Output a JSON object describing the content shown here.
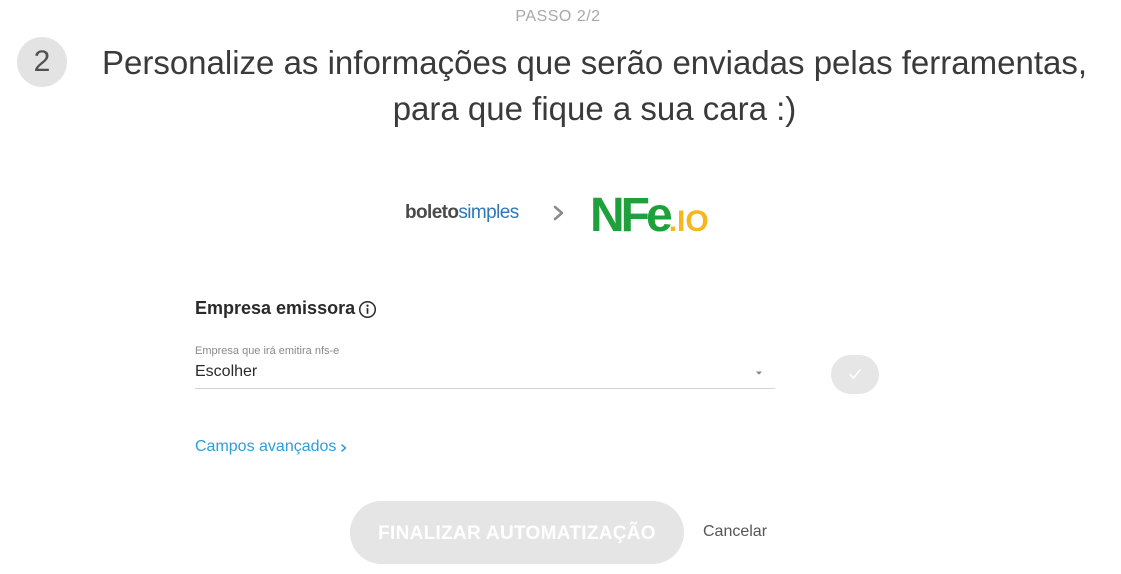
{
  "header": {
    "step_label": "PASSO 2/2",
    "step_number": "2",
    "title": "Personalize as informações que serão enviadas pelas ferramentas, para que fique a sua cara :)"
  },
  "logos": {
    "source_part1": "boleto",
    "source_part2": "simples",
    "target_part1": "NFe",
    "target_part2": ".IO"
  },
  "form": {
    "section_title": "Empresa emissora",
    "field_label": "Empresa que irá emitira nfs-e",
    "select_value": "Escolher"
  },
  "advanced": {
    "link_label": "Campos avançados"
  },
  "actions": {
    "finish_label": "FINALIZAR AUTOMATIZAÇÃO",
    "cancel_label": "Cancelar"
  },
  "colors": {
    "accent_link": "#2b9fd8",
    "disabled_button": "#e5e5e5",
    "nfe_green": "#1ea13a",
    "nfe_yellow": "#f5b81c",
    "boleto_blue": "#2f77b7"
  },
  "icons": {
    "info": "info-circle-icon",
    "separator": "chevron-right-icon",
    "caret": "caret-down-icon",
    "confirm": "check-icon",
    "advanced": "chevron-right-icon"
  }
}
